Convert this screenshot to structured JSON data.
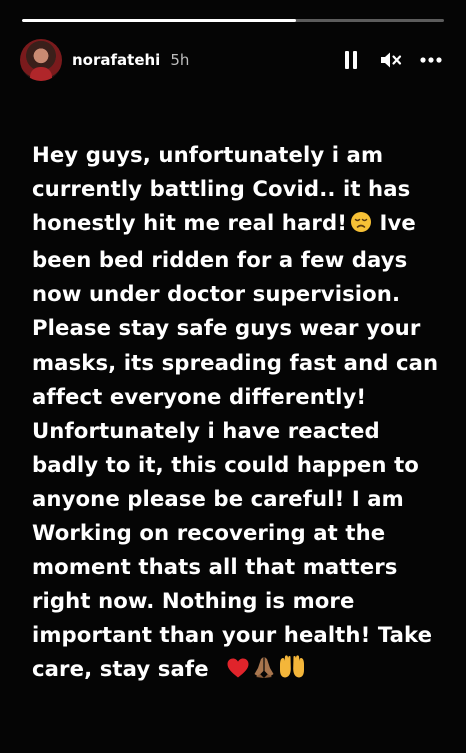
{
  "story": {
    "progress": 0.65,
    "colors": {
      "background": "#050505",
      "progress_fill": "#ffffff",
      "progress_track": "rgba(255,255,255,0.35)",
      "heart": "#e0242b",
      "hands": "#f4b63a"
    }
  },
  "header": {
    "username": "norafatehi",
    "timestamp": "5h",
    "icons": {
      "pause": "pause-icon",
      "mute": "speaker-muted-icon",
      "more": "more-options-icon"
    }
  },
  "content": {
    "lines": [
      "Hey guys, unfortunately i am",
      "currently battling Covid.. it has",
      "honestly hit me real hard!",
      "been bed ridden for a few days",
      "now under doctor supervision.",
      "Please stay safe guys wear your",
      "masks, its spreading fast and can",
      "affect everyone differently!",
      "Unfortunately i have reacted",
      "badly to it, this could happen to",
      "anyone please be careful! I am",
      "Working on recovering at the",
      "moment thats all that matters",
      "right now. Nothing is more",
      "important than your health! Take",
      "care, stay safe"
    ],
    "line3_tail": " Ive",
    "emoji": {
      "sad": "disappointed-face-emoji",
      "heart": "red-heart-emoji",
      "pray": "folded-hands-emoji",
      "palms": "palms-up-emoji"
    }
  }
}
